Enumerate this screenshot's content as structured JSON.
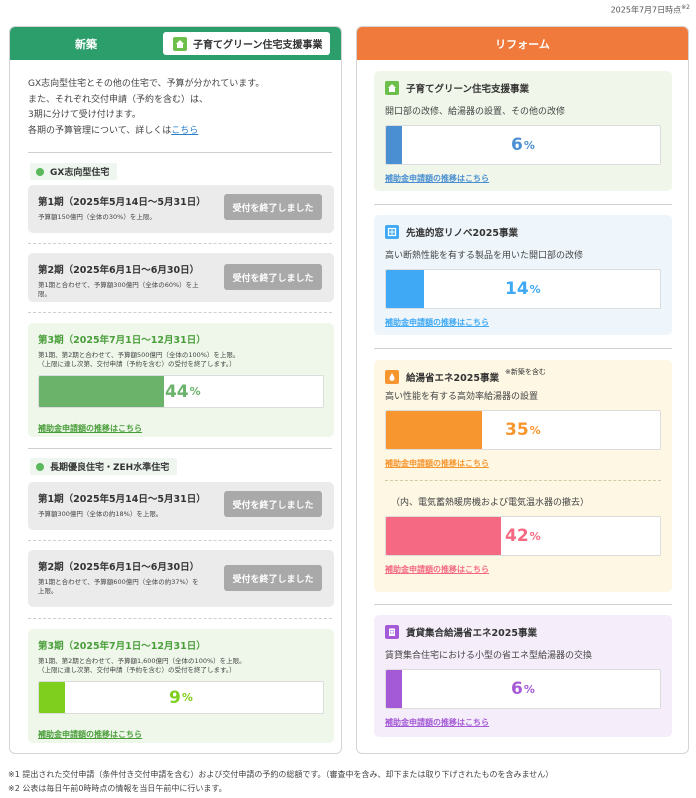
{
  "as_of": "2025年7月7日時点",
  "as_of_mark": "※2",
  "left": {
    "header": "新築",
    "tag": "子育てグリーン住宅支援事業",
    "intro_lines": [
      "GX志向型住宅とその他の住宅で、予算が分かれています。",
      "また、それぞれ交付申請（予約を含む）は、",
      "3期に分けて受け付けます。"
    ],
    "intro_last": "各期の予算管理について、詳しくは",
    "intro_link": "こちら",
    "gx": {
      "label": "GX志向型住宅",
      "p1_title": "第1期（2025年5月14日～5月31日）",
      "p1_note": "予算額150億円（全体の30%）を上限。",
      "p1_button": "受付を終了しました",
      "p2_title": "第2期（2025年6月1日～6月30日）",
      "p2_note": "第1期と合わせて、予算額300億円（全体の60%）を上限。",
      "p2_button": "受付を終了しました",
      "p3_title": "第3期（2025年7月1日～12月31日）",
      "p3_note1": "第1期、第2期と合わせて、予算額500億円（全体の100%）を上限。",
      "p3_note2": "（上限に達し次第、交付申請（予約を含む）の受付を終了します。）",
      "p3_value": "44",
      "p3_unit": "%",
      "p3_link": "補助金申請額の推移はこちら"
    },
    "zeh": {
      "label": "長期優良住宅・ZEH水準住宅",
      "p1_title": "第1期（2025年5月14日～5月31日）",
      "p1_note": "予算額300億円（全体の約18%）を上限。",
      "p1_button": "受付を終了しました",
      "p2_title": "第2期（2025年6月1日～6月30日）",
      "p2_note": "第1期と合わせて、予算額600億円（全体の約37%）を上限。",
      "p2_button": "受付を終了しました",
      "p3_title": "第3期（2025年7月1日～12月31日）",
      "p3_note1": "第1期、第2期と合わせて、予算額1,600億円（全体の100%）を上限。",
      "p3_note2": "（上限に達し次第、交付申請（予約を含む）の受付を終了します。）",
      "p3_value": "9",
      "p3_unit": "%",
      "p3_link": "補助金申請額の推移はこちら"
    }
  },
  "right": {
    "header": "リフォーム",
    "cards": {
      "kosodate": {
        "title": "子育てグリーン住宅支援事業",
        "desc": "開口部の改修、給湯器の設置、その他の改修",
        "value": "6",
        "unit": "%",
        "link": "補助金申請額の推移はこちら",
        "color": "#4a8fd1"
      },
      "mado": {
        "title": "先進的窓リノベ2025事業",
        "desc": "高い断熱性能を有する製品を用いた開口部の改修",
        "value": "14",
        "unit": "%",
        "link": "補助金申請額の推移はこちら",
        "color": "#3fa9f5"
      },
      "kyuto": {
        "title": "給湯省エネ2025事業",
        "note": "※新築を含む",
        "desc": "高い性能を有する高効率給湯器の設置",
        "value": "35",
        "unit": "%",
        "link": "補助金申請額の推移はこちら",
        "color": "#f7962f",
        "sub_desc": "（内、電気蓄熱暖房機および電気温水器の撤去）",
        "sub_value": "42",
        "sub_unit": "%",
        "sub_link": "補助金申請額の推移はこちら",
        "sub_color": "#f56a82"
      },
      "chintai": {
        "title": "賃貸集合給湯省エネ2025事業",
        "desc": "賃貸集合住宅における小型の省エネ型給湯器の交換",
        "value": "6",
        "unit": "%",
        "link": "補助金申請額の推移はこちら",
        "color": "#a45ad6"
      }
    }
  },
  "footnotes": [
    "※1 提出された交付申請（条件付き交付申請を含む）および交付申請の予約の総額です。（審査中を含み、却下または取り下げされたものを含みません）",
    "※2 公表は毎日午前0時時点の情報を当日午前中に行います。"
  ]
}
